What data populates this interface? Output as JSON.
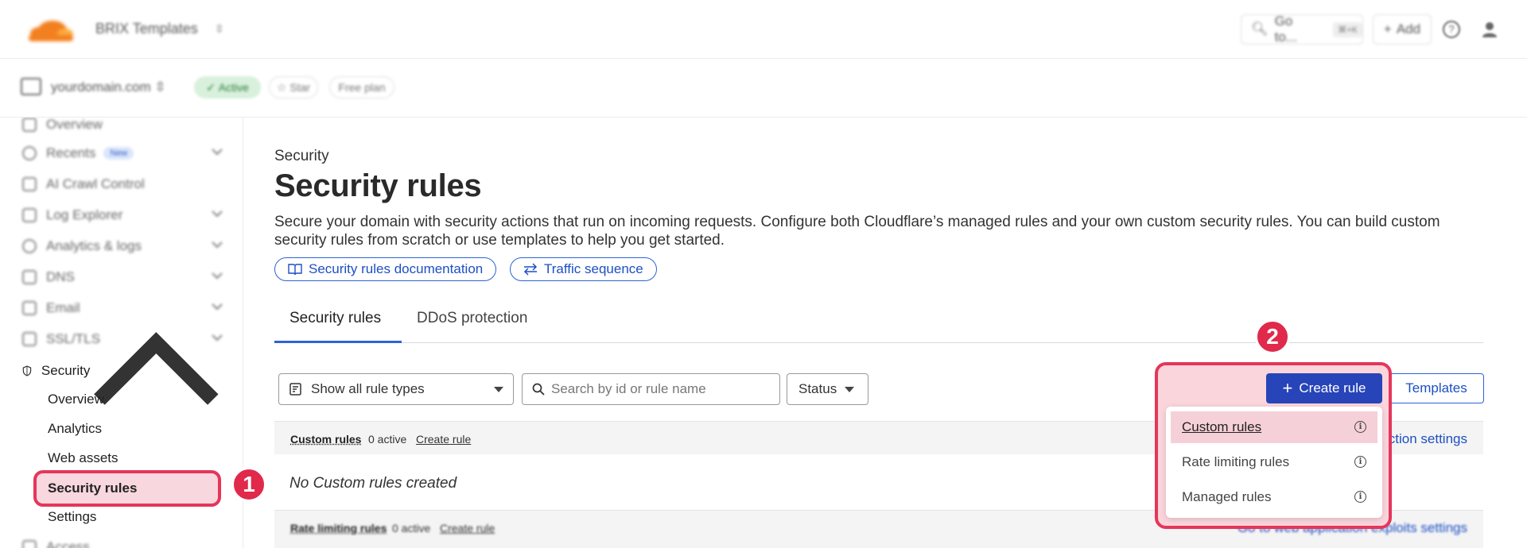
{
  "topbar": {
    "account_name": "BRIX Templates",
    "goto_label": "Go to...",
    "goto_shortcut": "⌘+K",
    "add_label": "Add"
  },
  "domainbar": {
    "domain": "yourdomain.com",
    "status": "Active",
    "star_label": "Star",
    "plan": "Free plan"
  },
  "sidebar": {
    "items": [
      {
        "label": "Overview"
      },
      {
        "label": "Recents",
        "badge": "New"
      },
      {
        "label": "AI Crawl Control"
      },
      {
        "label": "Log Explorer"
      },
      {
        "label": "Analytics & logs"
      },
      {
        "label": "DNS"
      },
      {
        "label": "Email"
      },
      {
        "label": "SSL/TLS"
      },
      {
        "label": "Security"
      },
      {
        "label": "Access"
      }
    ],
    "security_sub": [
      {
        "label": "Overview"
      },
      {
        "label": "Analytics"
      },
      {
        "label": "Web assets"
      },
      {
        "label": "Security rules"
      },
      {
        "label": "Settings"
      }
    ]
  },
  "annotations": {
    "marker1": "1",
    "marker2": "2"
  },
  "main": {
    "breadcrumb": "Security",
    "title": "Security rules",
    "description": "Secure your domain with security actions that run on incoming requests. Configure both Cloudflare’s managed rules and your own custom security rules. You can build custom security rules from scratch or use templates to help you get started.",
    "doc_link": "Security rules documentation",
    "traffic_link": "Traffic sequence",
    "tabs": [
      {
        "label": "Security rules"
      },
      {
        "label": "DDoS protection"
      }
    ],
    "filters": {
      "rule_types": "Show all rule types",
      "search_placeholder": "Search by id or rule name",
      "status": "Status"
    },
    "create_rule": "Create rule",
    "templates": "Templates",
    "sections": [
      {
        "title": "Custom rules",
        "count": "0 active",
        "create": "Create rule",
        "link": "ection settings",
        "empty": "No Custom rules created"
      },
      {
        "title": "Rate limiting rules",
        "count": "0 active",
        "create": "Create rule",
        "link": "Go to web application exploits settings"
      }
    ],
    "dropdown": [
      {
        "label": "Custom rules"
      },
      {
        "label": "Rate limiting rules"
      },
      {
        "label": "Managed rules"
      }
    ]
  },
  "colors": {
    "accent": "#2c63d6",
    "primary_button": "#2744b8",
    "highlight": "#e5365a",
    "highlight_fill": "#fbd5dc"
  }
}
